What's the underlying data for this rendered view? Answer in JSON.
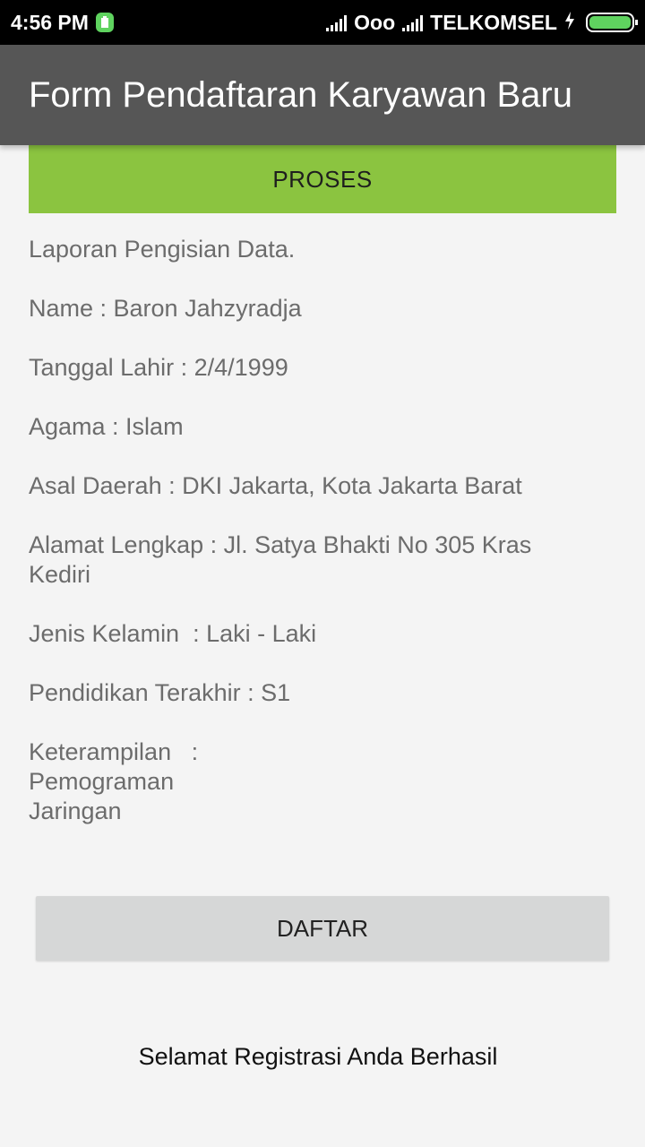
{
  "status_bar": {
    "time": "4:56 PM",
    "carrier1": "Ooo",
    "carrier2": "TELKOMSEL",
    "icons": [
      "notification-icon",
      "signal-icon",
      "signal-icon",
      "charging-icon",
      "battery-icon"
    ]
  },
  "app_bar": {
    "title": "Form Pendaftaran Karyawan Baru"
  },
  "buttons": {
    "proses": "PROSES",
    "daftar": "DAFTAR"
  },
  "report": {
    "heading": "Laporan Pengisian Data.",
    "name": "Name : Baron Jahzyradja",
    "birth": "Tanggal Lahir : 2/4/1999",
    "religion": "Agama : Islam",
    "origin": "Asal Daerah : DKI Jakarta, Kota Jakarta Barat",
    "address": "Alamat Lengkap : Jl. Satya Bhakti No 305 Kras Kediri",
    "gender": "Jenis Kelamin  : Laki - Laki",
    "education": "Pendidikan Terakhir : S1",
    "skills": "Keterampilan   :\nPemograman\nJaringan"
  },
  "result": "Selamat Registrasi Anda Berhasil",
  "colors": {
    "accent": "#8bc440",
    "app_bar": "#565656",
    "background": "#f4f4f4"
  }
}
